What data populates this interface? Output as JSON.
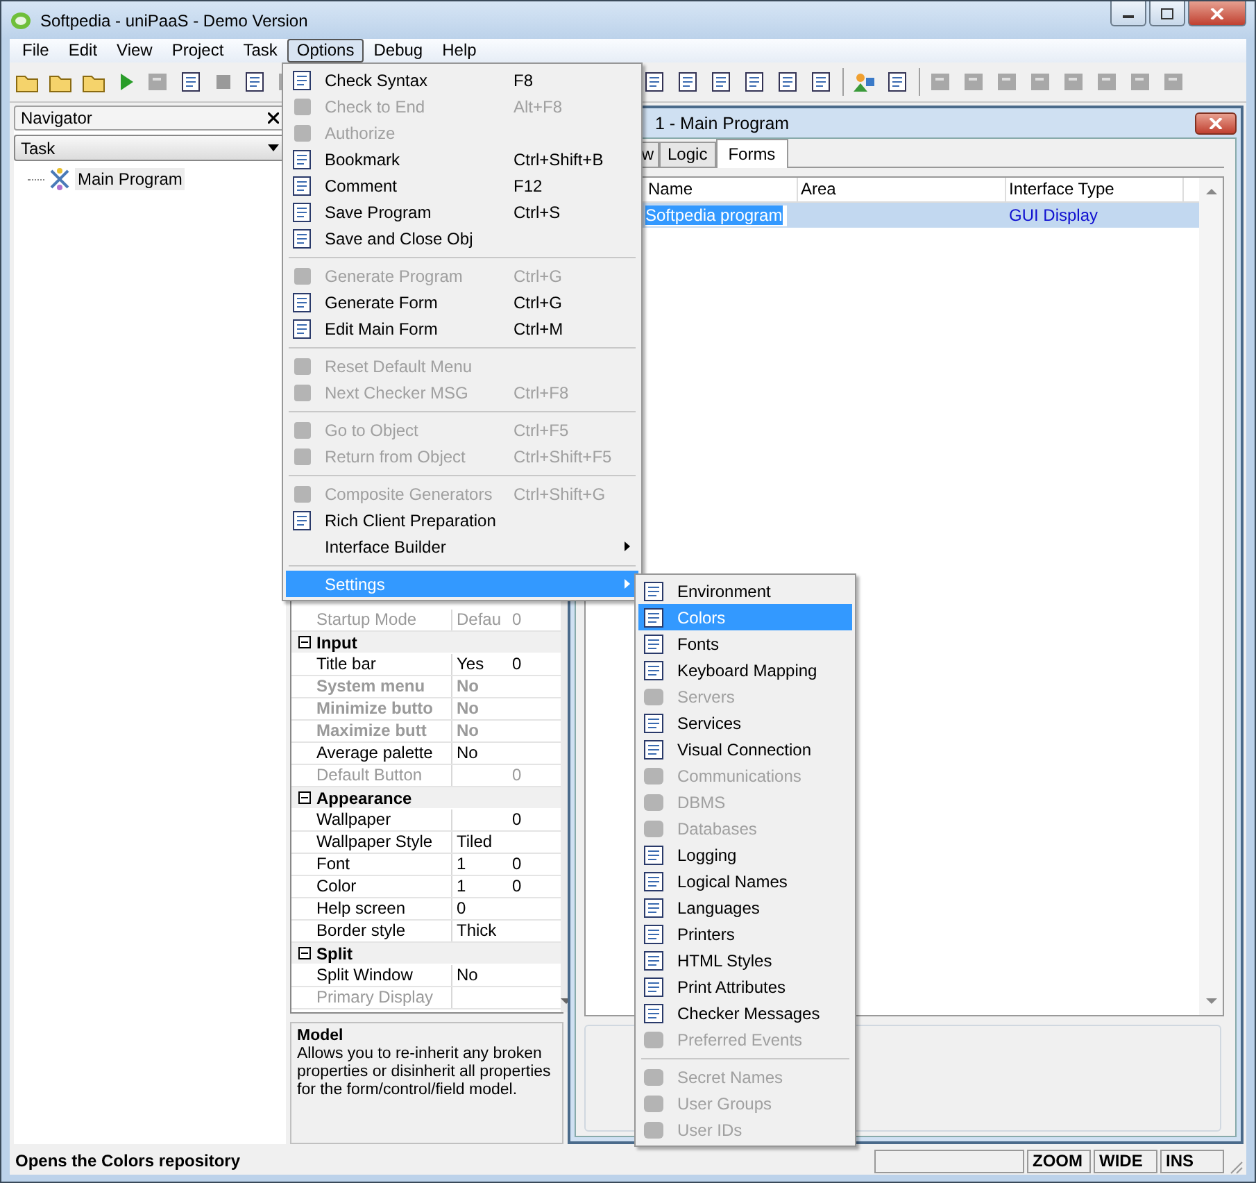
{
  "window": {
    "title": "Softpedia - uniPaaS - Demo Version"
  },
  "menubar": [
    {
      "label": "File",
      "selected": false
    },
    {
      "label": "Edit",
      "selected": false
    },
    {
      "label": "View",
      "selected": false
    },
    {
      "label": "Project",
      "selected": false
    },
    {
      "label": "Task",
      "selected": false
    },
    {
      "label": "Options",
      "selected": true
    },
    {
      "label": "Debug",
      "selected": false
    },
    {
      "label": "Help",
      "selected": false
    }
  ],
  "navigator": {
    "title": "Navigator",
    "dropdown": "Task",
    "tree": [
      {
        "label": "Main Program",
        "selected": true
      }
    ]
  },
  "properties": [
    {
      "kind": "prop",
      "name": "Startup Mode",
      "value": "Defau",
      "extra": "0",
      "disabled": true,
      "bold": false
    },
    {
      "kind": "header",
      "name": "Input",
      "expanded": true
    },
    {
      "kind": "prop",
      "name": "Title bar",
      "value": "Yes",
      "extra": "0",
      "disabled": false,
      "bold": false
    },
    {
      "kind": "prop",
      "name": "System menu",
      "value": "No",
      "disabled": true,
      "bold": true
    },
    {
      "kind": "prop",
      "name": "Minimize butto",
      "value": "No",
      "disabled": true,
      "bold": true
    },
    {
      "kind": "prop",
      "name": "Maximize butt",
      "value": "No",
      "disabled": true,
      "bold": true
    },
    {
      "kind": "prop",
      "name": "Average palette",
      "value": "No",
      "disabled": false,
      "bold": false
    },
    {
      "kind": "prop",
      "name": "Default Button",
      "extra": "0",
      "disabled": true,
      "bold": false
    },
    {
      "kind": "header",
      "name": "Appearance",
      "expanded": true
    },
    {
      "kind": "prop",
      "name": "Wallpaper",
      "extra": "0",
      "disabled": false,
      "bold": false
    },
    {
      "kind": "prop",
      "name": "Wallpaper Style",
      "value": "Tiled",
      "disabled": false,
      "bold": false
    },
    {
      "kind": "prop",
      "name": "Font",
      "value": "1",
      "extra": "0",
      "disabled": false,
      "bold": false
    },
    {
      "kind": "prop",
      "name": "Color",
      "value": "1",
      "extra": "0",
      "disabled": false,
      "bold": false
    },
    {
      "kind": "prop",
      "name": "Help screen",
      "value": "0",
      "disabled": false,
      "bold": false
    },
    {
      "kind": "prop",
      "name": "Border style",
      "value": "Thick",
      "disabled": false,
      "bold": false
    },
    {
      "kind": "header",
      "name": "Split",
      "expanded": true
    },
    {
      "kind": "prop",
      "name": "Split Window",
      "value": "No",
      "disabled": false,
      "bold": false
    },
    {
      "kind": "prop",
      "name": "Primary Display",
      "disabled": true,
      "bold": false
    }
  ],
  "description": {
    "title": "Model",
    "text": "Allows you to re-inherit any broken properties or disinherit all properties for the form/control/field model."
  },
  "child_window": {
    "title": "1 -   Main Program",
    "tabs": [
      {
        "label": "w",
        "selected": false
      },
      {
        "label": "Logic",
        "selected": false
      },
      {
        "label": "Forms",
        "selected": true
      }
    ],
    "table": {
      "columns": [
        "Name",
        "Area",
        "Interface Type"
      ],
      "rows": [
        {
          "name": "Softpedia program",
          "interface_type": "GUI Display",
          "selected": true
        }
      ]
    }
  },
  "options_menu": [
    {
      "kind": "item",
      "label": "Check Syntax",
      "shortcut": "F8",
      "disabled": false,
      "selected": false,
      "submenu": false
    },
    {
      "kind": "item",
      "label": "Check to End",
      "shortcut": "Alt+F8",
      "disabled": true,
      "selected": false,
      "submenu": false
    },
    {
      "kind": "item",
      "label": "Authorize",
      "disabled": true,
      "selected": false,
      "submenu": false
    },
    {
      "kind": "item",
      "label": "Bookmark",
      "shortcut": "Ctrl+Shift+B",
      "disabled": false,
      "selected": false,
      "submenu": false
    },
    {
      "kind": "item",
      "label": "Comment",
      "shortcut": "F12",
      "disabled": false,
      "selected": false,
      "submenu": false
    },
    {
      "kind": "item",
      "label": "Save Program",
      "shortcut": "Ctrl+S",
      "disabled": false,
      "selected": false,
      "submenu": false
    },
    {
      "kind": "item",
      "label": "Save and Close Obj",
      "disabled": false,
      "selected": false,
      "submenu": false
    },
    {
      "kind": "separator"
    },
    {
      "kind": "item",
      "label": "Generate Program",
      "shortcut": "Ctrl+G",
      "disabled": true,
      "selected": false,
      "submenu": false
    },
    {
      "kind": "item",
      "label": "Generate Form",
      "shortcut": "Ctrl+G",
      "disabled": false,
      "selected": false,
      "submenu": false
    },
    {
      "kind": "item",
      "label": "Edit Main Form",
      "shortcut": "Ctrl+M",
      "disabled": false,
      "selected": false,
      "submenu": false
    },
    {
      "kind": "separator"
    },
    {
      "kind": "item",
      "label": "Reset Default Menu",
      "disabled": true,
      "selected": false,
      "submenu": false
    },
    {
      "kind": "item",
      "label": "Next Checker MSG",
      "shortcut": "Ctrl+F8",
      "disabled": true,
      "selected": false,
      "submenu": false
    },
    {
      "kind": "separator"
    },
    {
      "kind": "item",
      "label": "Go to Object",
      "shortcut": "Ctrl+F5",
      "disabled": true,
      "selected": false,
      "submenu": false
    },
    {
      "kind": "item",
      "label": "Return from Object",
      "shortcut": "Ctrl+Shift+F5",
      "disabled": true,
      "selected": false,
      "submenu": false
    },
    {
      "kind": "separator"
    },
    {
      "kind": "item",
      "label": "Composite Generators",
      "shortcut": "Ctrl+Shift+G",
      "disabled": true,
      "selected": false,
      "submenu": false
    },
    {
      "kind": "item",
      "label": "Rich Client Preparation",
      "disabled": false,
      "selected": false,
      "submenu": false
    },
    {
      "kind": "plain",
      "label": "Interface Builder",
      "disabled": false,
      "selected": false,
      "submenu": true
    },
    {
      "kind": "separator"
    },
    {
      "kind": "plain",
      "label": "Settings",
      "disabled": false,
      "selected": true,
      "submenu": true
    }
  ],
  "settings_menu": [
    {
      "kind": "item",
      "label": "Environment",
      "disabled": false,
      "selected": false
    },
    {
      "kind": "item",
      "label": "Colors",
      "disabled": false,
      "selected": true
    },
    {
      "kind": "item",
      "label": "Fonts",
      "disabled": false,
      "selected": false
    },
    {
      "kind": "item",
      "label": "Keyboard Mapping",
      "disabled": false,
      "selected": false
    },
    {
      "kind": "item",
      "label": "Servers",
      "disabled": true,
      "selected": false
    },
    {
      "kind": "item",
      "label": "Services",
      "disabled": false,
      "selected": false
    },
    {
      "kind": "item",
      "label": "Visual Connection",
      "disabled": false,
      "selected": false
    },
    {
      "kind": "item",
      "label": "Communications",
      "disabled": true,
      "selected": false
    },
    {
      "kind": "item",
      "label": "DBMS",
      "disabled": true,
      "selected": false
    },
    {
      "kind": "item",
      "label": "Databases",
      "disabled": true,
      "selected": false
    },
    {
      "kind": "item",
      "label": "Logging",
      "disabled": false,
      "selected": false
    },
    {
      "kind": "item",
      "label": "Logical Names",
      "disabled": false,
      "selected": false
    },
    {
      "kind": "item",
      "label": "Languages",
      "disabled": false,
      "selected": false
    },
    {
      "kind": "item",
      "label": "Printers",
      "disabled": false,
      "selected": false
    },
    {
      "kind": "item",
      "label": "HTML Styles",
      "disabled": false,
      "selected": false
    },
    {
      "kind": "item",
      "label": "Print Attributes",
      "disabled": false,
      "selected": false
    },
    {
      "kind": "item",
      "label": "Checker Messages",
      "disabled": false,
      "selected": false
    },
    {
      "kind": "item",
      "label": "Preferred Events",
      "disabled": true,
      "selected": false
    },
    {
      "kind": "separator"
    },
    {
      "kind": "item",
      "label": "Secret Names",
      "disabled": true,
      "selected": false
    },
    {
      "kind": "item",
      "label": "User Groups",
      "disabled": true,
      "selected": false
    },
    {
      "kind": "item",
      "label": "User IDs",
      "disabled": true,
      "selected": false
    }
  ],
  "status_bar": {
    "message": "Opens the Colors repository",
    "indicators": [
      "ZOOM",
      "WIDE",
      "INS"
    ]
  }
}
